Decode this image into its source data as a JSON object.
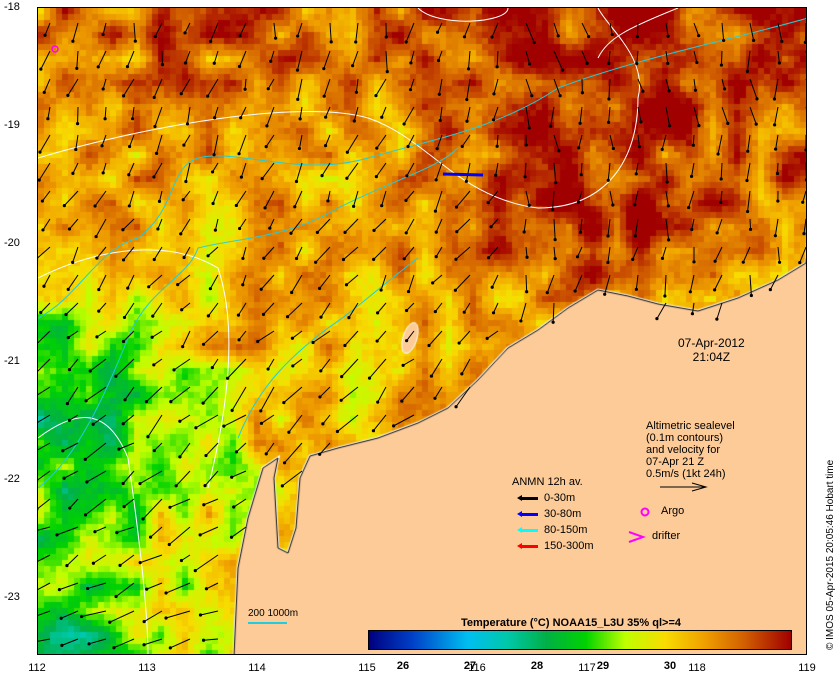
{
  "map": {
    "date": "07-Apr-2012",
    "time": "21:04Z",
    "x_ticks": [
      "112",
      "113",
      "114",
      "115",
      "116",
      "117",
      "118",
      "119"
    ],
    "y_ticks": [
      "-18",
      "-19",
      "-20",
      "-21",
      "-22",
      "-23"
    ],
    "land_color": "#FDCB98",
    "contour_color": "#FFFFFF",
    "isobath_color": "#22CCDD"
  },
  "altimetry_note": {
    "lines": [
      "Altimetric sealevel",
      "(0.1m contours)",
      "and velocity for",
      "07-Apr 21 Z",
      "0.5m/s (1kt 24h)"
    ]
  },
  "legend": {
    "title": "ANMN 12h av.",
    "items": [
      {
        "label": "0-30m",
        "color": "#000000"
      },
      {
        "label": "30-80m",
        "color": "#0000FF"
      },
      {
        "label": "80-150m",
        "color": "#00FFFF"
      },
      {
        "label": "150-300m",
        "color": "#FF0000"
      }
    ],
    "argo": "Argo",
    "drifter": "drifter",
    "marker_color": "#FF00FF"
  },
  "isobath_label": "200  1000m",
  "colorbar": {
    "title": "Temperature (°C) NOAA15_L3U 35% ql>=4",
    "ticks": [
      "26",
      "27",
      "28",
      "29",
      "30"
    ]
  },
  "credit": "© IMOS 05-Apr-2015 20:05:46 Hobart time"
}
